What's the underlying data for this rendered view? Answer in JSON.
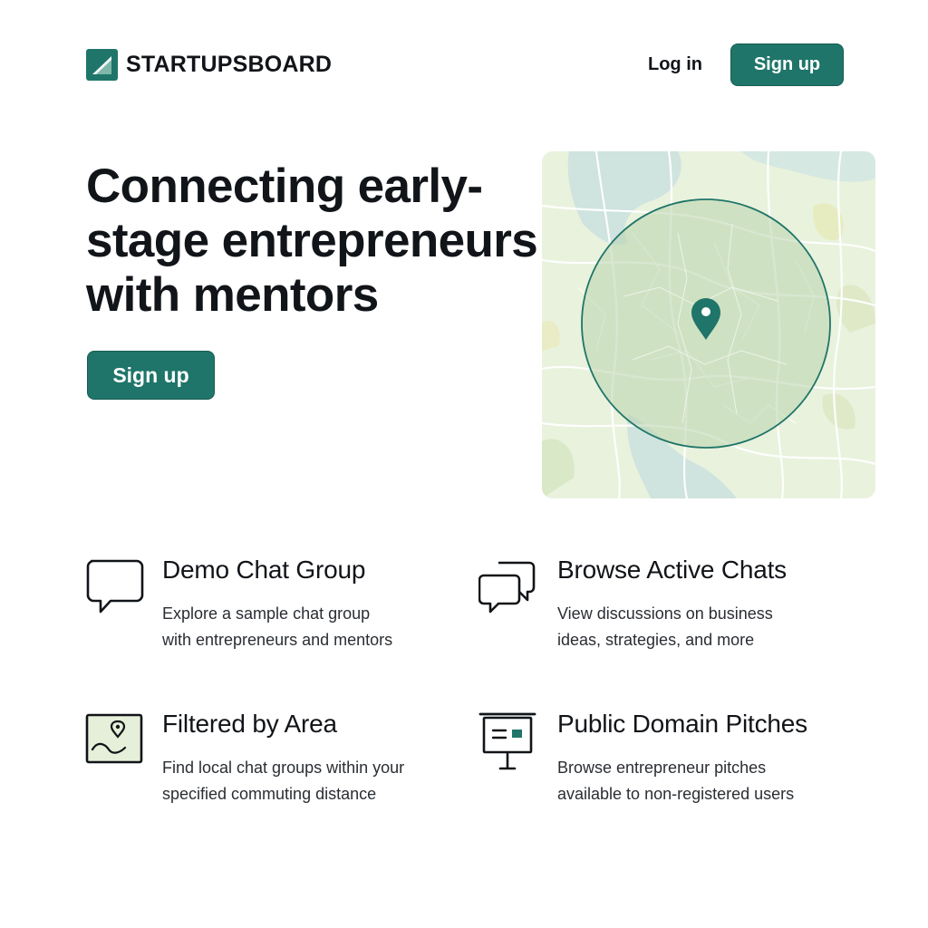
{
  "header": {
    "brand": "STARTUPSBOARD",
    "login_label": "Log in",
    "signup_label": "Sign up"
  },
  "hero": {
    "title_lines": [
      "Connecting early-",
      "stage entrepreneurs",
      "with mentors"
    ],
    "signup_label": "Sign up"
  },
  "features": [
    {
      "icon": "chat-bubble-icon",
      "title": "Demo Chat Group",
      "desc_lines": [
        "Explore a sample chat group",
        "with entrepreneurs and mentors"
      ]
    },
    {
      "icon": "chat-bubbles-icon",
      "title": "Browse Active Chats",
      "desc_lines": [
        "View discussions on business",
        "ideas, strategies, and more"
      ]
    },
    {
      "icon": "map-pin-icon",
      "title": "Filtered by Area",
      "desc_lines": [
        "Find local chat groups within your",
        "specified commuting distance"
      ]
    },
    {
      "icon": "presentation-board-icon",
      "title": "Public Domain Pitches",
      "desc_lines": [
        "Browse entrepreneur pitches",
        "available to non-registered users"
      ]
    }
  ],
  "colors": {
    "accent": "#1f7569",
    "map_land": "#e9f2dd",
    "map_water": "#cfe3df",
    "radius_fill": "#b9d4ad"
  }
}
